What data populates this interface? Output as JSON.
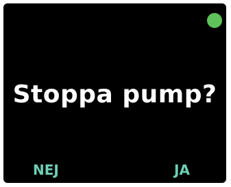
{
  "screen": {
    "prompt": "Stoppa pump?",
    "left_softkey_label": "NEJ",
    "right_softkey_label": "JA"
  },
  "status_indicator": {
    "icon": "status-dot",
    "color": "#5fc25a"
  },
  "colors": {
    "background": "#000000",
    "prompt_text": "#ffffff",
    "softkey_text": "#6fcfb5"
  }
}
